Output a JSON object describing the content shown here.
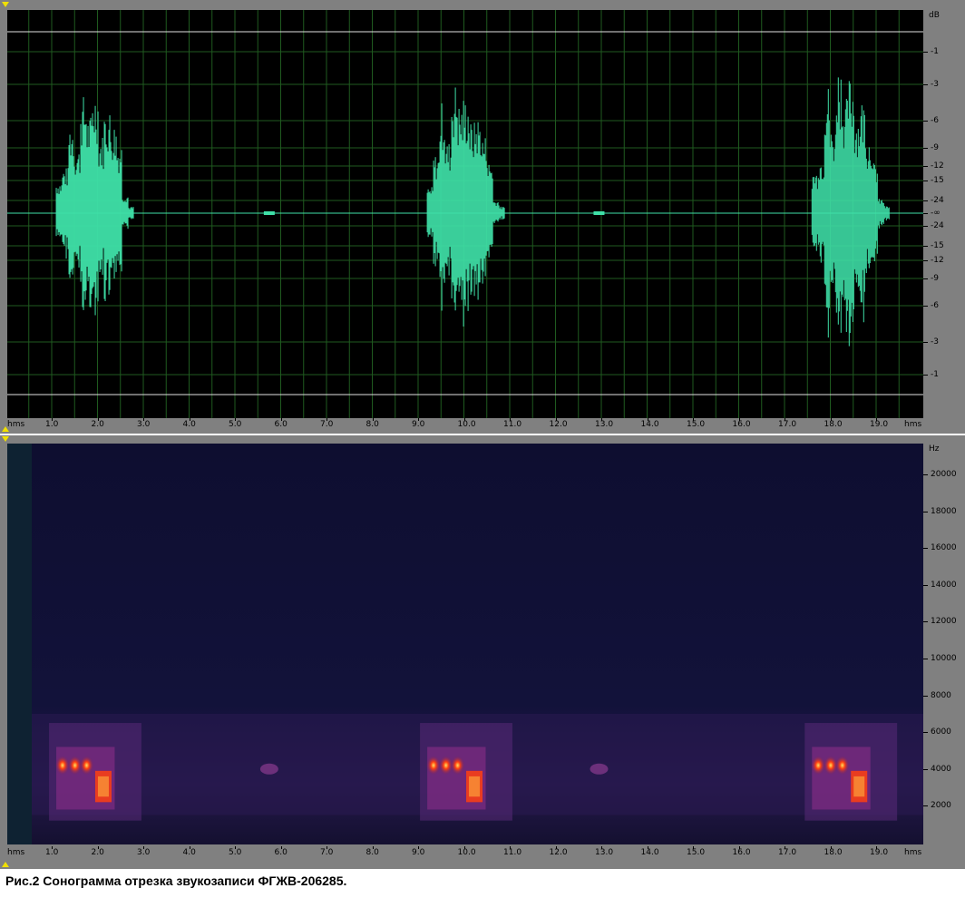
{
  "waveform": {
    "unit_label": "dB",
    "db_labels": [
      "-1",
      "-3",
      "-6",
      "-9",
      "-12",
      "-15",
      "-24",
      "-∞",
      "-24",
      "-15",
      "-12",
      "-9",
      "-6",
      "-3",
      "-1"
    ],
    "colors": {
      "background": "#000000",
      "wave": "#3fe0a8",
      "grid": "#1f5a1f",
      "clip_line": "#e0e0e0"
    }
  },
  "spectrogram": {
    "unit_label": "Hz",
    "hz_labels": [
      "20000",
      "18000",
      "16000",
      "14000",
      "12000",
      "10000",
      "8000",
      "6000",
      "4000",
      "2000"
    ],
    "colors": {
      "background": "#0c0c2e",
      "hot": "#ff4010"
    }
  },
  "time_ruler": {
    "unit_label": "hms",
    "labels": [
      "1.0",
      "2.0",
      "3.0",
      "4.0",
      "5.0",
      "6.0",
      "7.0",
      "8.0",
      "9.0",
      "10.0",
      "11.0",
      "12.0",
      "13.0",
      "14.0",
      "15.0",
      "16.0",
      "17.0",
      "18.0",
      "19.0"
    ]
  },
  "calls": [
    {
      "start": 1.1,
      "end": 2.8
    },
    {
      "start": 9.2,
      "end": 10.9
    },
    {
      "start": 17.6,
      "end": 19.3
    }
  ],
  "caption": "Рис.2  Сонограмма отрезка звукозаписи ФГЖВ-206285."
}
